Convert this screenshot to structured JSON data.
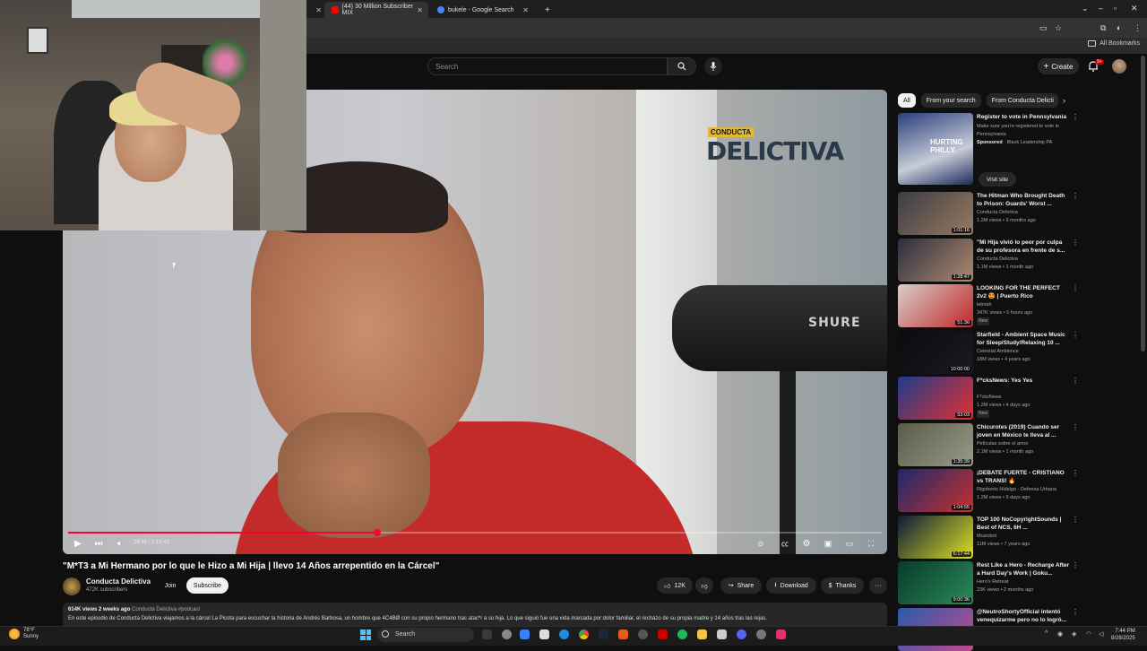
{
  "browser": {
    "tabs": [
      {
        "label": "(44) 30 Million Subscriber MIX",
        "color": "#ff0000"
      },
      {
        "label": "bukele - Google Search",
        "color": "#4285f4"
      }
    ],
    "new_tab": "+",
    "all_bookmarks": "All Bookmarks"
  },
  "yt_header": {
    "search_placeholder": "Search",
    "create_label": "Create",
    "notif_count": "9+"
  },
  "video": {
    "logo_small": "CONDUCTA",
    "logo_big": "DELICTIVA",
    "mic_brand": "SHURE",
    "time": "28:40 / 1:15:42",
    "progress": 0.38
  },
  "meta": {
    "title": "\"M*T3 a Mi Hermano por lo que le Hizo a Mi Hija | llevo 14 Años arrepentido en la Cárcel\"",
    "channel": "Conducta Delictiva",
    "subs": "472K subscribers",
    "join": "Join",
    "subscribe": "Subscribe",
    "likes": "12K",
    "share": "Share",
    "download": "Download",
    "thanks": "Thanks",
    "more": "···",
    "desc_meta": "614K views  2 weeks ago",
    "desc_tags": "Conducta Delictiva #podcast",
    "desc_text": "En este episodio de Conducta Delictiva viajamos a la cárcel La Picota para escuchar la historia de Andrés Barbosa, un hombre que 4C4BØ con su propio hermano tras atac*r a su hija. Lo que siguió fue una vida marcada por dolor familiar, el rechazo de su propia madre y 14 años tras las rejas."
  },
  "sidebar": {
    "chips": [
      "All",
      "From your search",
      "From Conducta Delicti"
    ],
    "ad": {
      "title": "Register to vote in Pennsylvania",
      "desc": "Make sure you're registered to vote in Pennsylvania",
      "sponsor": "Sponsored",
      "advertiser": "· Black Leadership PA",
      "cta": "Visit site",
      "thumb_text": "HURTING PHILLY."
    },
    "items": [
      {
        "title": "The Hitman Who Brought Death to Prison: Guards' Worst ...",
        "channel": "Conducta Delictiva",
        "stats": "1.2M views • 9 months ago",
        "dur": "1:01:16",
        "c1": "#3b3d45",
        "c2": "#9a7a60",
        "new": ""
      },
      {
        "title": "\"Mi Hija vivió lo peor por culpa de su profesora en frente de s...",
        "channel": "Conducta Delictiva",
        "stats": "1.1M views • 1 month ago",
        "dur": "1:28:47",
        "c1": "#2b2f3e",
        "c2": "#b08a6e",
        "new": ""
      },
      {
        "title": "LOOKING FOR THE PERFECT 2v2 😍 | Puerto Rico",
        "channel": "lebriah",
        "stats": "347K views • 5 hours ago",
        "dur": "51:36",
        "c1": "#d8d0c8",
        "c2": "#c0262a",
        "new": "New"
      },
      {
        "title": "Starfield - Ambient Space Music for Sleep/Study/Relaxing 10 ...",
        "channel": "Celestial Ambience",
        "stats": "18M views • 4 years ago",
        "dur": "10:00:00",
        "c1": "#0a0a10",
        "c2": "#1a1a22",
        "new": ""
      },
      {
        "title": "F*cksNews: Yes Yes",
        "channel": "F*cksNews",
        "stats": "1.2M views • 4 days ago",
        "dur": "53:03",
        "c1": "#1d3b8a",
        "c2": "#e23030",
        "new": "New"
      },
      {
        "title": "Chicurotes (2019)  Cuando ser joven en México te lleva al ...",
        "channel": "Películas sobre el amor",
        "stats": "2.1M views • 1 month ago",
        "dur": "1:35:39",
        "c1": "#5b5b4a",
        "c2": "#9a9a8a",
        "new": ""
      },
      {
        "title": "¡DEBATE FUERTE - CRISTIANO vs TRANS! 🔥",
        "channel": "Rigoberto Hidalgo - Defensa Urbana",
        "stats": "1.2M views • 9 days ago",
        "dur": "1:04:55",
        "c1": "#1b2a6a",
        "c2": "#c83030",
        "new": ""
      },
      {
        "title": "TOP 100 NoCopyrightSounds | Best of NCS, 6H ...",
        "channel": "Musicbot",
        "stats": "11M views • 7 years ago",
        "dur": "6:17:44",
        "c1": "#0a1a3a",
        "c2": "#e0e020",
        "new": ""
      },
      {
        "title": "Rest Like a Hero - Recharge After a Hard Day's Work | Goku...",
        "channel": "Hero's Retreat",
        "stats": "23K views • 2 months ago",
        "dur": "9:00:36",
        "c1": "#0a3a2a",
        "c2": "#2a8a5a",
        "new": ""
      },
      {
        "title": "@NeutroShortyOfficial intentó venequizarme pero no lo logró...",
        "channel": "",
        "stats": "",
        "dur": "",
        "c1": "#2a5aaa",
        "c2": "#c04a90",
        "new": ""
      }
    ]
  },
  "taskbar": {
    "temp": "78°F",
    "weather": "Sunny",
    "search": "Search",
    "time": "7:44 PM",
    "date": "8/28/2025"
  },
  "colors": {
    "accent": "#ff0033",
    "bg": "#0f0f0f",
    "chip": "#272727"
  }
}
